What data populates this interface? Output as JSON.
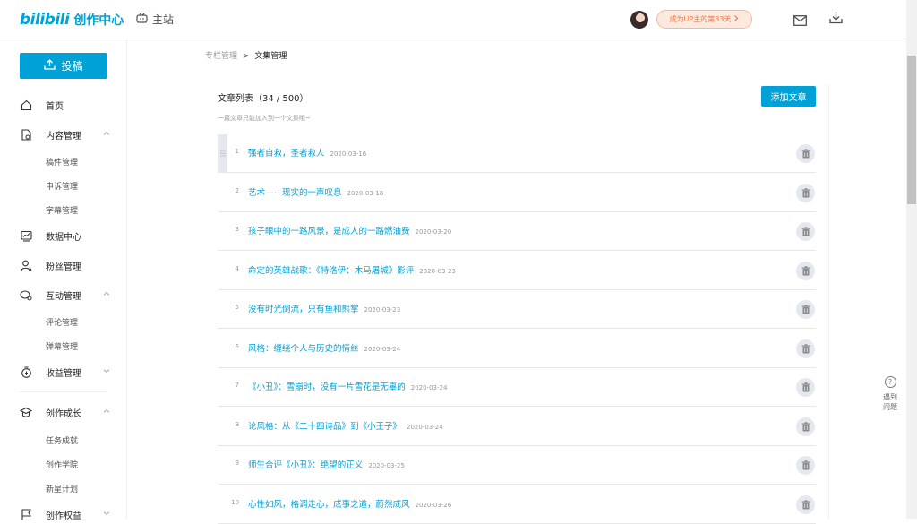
{
  "header": {
    "logo_bili": "bilibili",
    "logo_text": "创作中心",
    "home_label": "主站",
    "up_days_label": "成为UP主的第83天"
  },
  "sidebar": {
    "upload_label": "投稿",
    "items": [
      {
        "label": "首页",
        "icon": "home-icon"
      },
      {
        "label": "内容管理",
        "icon": "file-icon",
        "sub": [
          "稿件管理",
          "申诉管理",
          "字幕管理"
        ]
      },
      {
        "label": "数据中心",
        "icon": "chart-icon"
      },
      {
        "label": "粉丝管理",
        "icon": "fans-icon"
      },
      {
        "label": "互动管理",
        "icon": "chat-icon",
        "sub": [
          "评论管理",
          "弹幕管理"
        ]
      },
      {
        "label": "收益管理",
        "icon": "money-icon"
      },
      {
        "label": "创作成长",
        "icon": "grad-cap-icon",
        "sub": [
          "任务成就",
          "创作学院",
          "新星计划"
        ]
      },
      {
        "label": "创作权益",
        "icon": "flag-icon"
      }
    ]
  },
  "breadcrumb": {
    "parent": "专栏管理",
    "separator": ">",
    "current": "文集管理"
  },
  "list": {
    "title": "文章列表（34 / 500）",
    "tip": "一篇文章只能加入到一个文集哦~",
    "add_button": "添加文章",
    "rows": [
      {
        "index": "1",
        "title": "强者自救，圣者救人",
        "date": "2020-03-16"
      },
      {
        "index": "2",
        "title": "艺术——现实的一声叹息",
        "date": "2020-03-18"
      },
      {
        "index": "3",
        "title": "孩子眼中的一路风景，是成人的一路燃油费",
        "date": "2020-03-20"
      },
      {
        "index": "4",
        "title": "命定的英雄战歌：《特洛伊：木马屠城》影评",
        "date": "2020-03-23"
      },
      {
        "index": "5",
        "title": "没有时光倒流，只有鱼和熊掌",
        "date": "2020-03-23"
      },
      {
        "index": "6",
        "title": "风格：缠绕个人与历史的情丝",
        "date": "2020-03-24"
      },
      {
        "index": "7",
        "title": "《小丑》：雪崩时，没有一片雪花是无辜的",
        "date": "2020-03-24"
      },
      {
        "index": "8",
        "title": "论风格：从《二十四诗品》到《小王子》",
        "date": "2020-03-24"
      },
      {
        "index": "9",
        "title": "师生合评《小丑》：绝望的正义",
        "date": "2020-03-25"
      },
      {
        "index": "10",
        "title": "心性如风，格调走心，成事之道，蔚然成风",
        "date": "2020-03-26"
      }
    ]
  },
  "help": {
    "icon_glyph": "?",
    "line1": "遇到",
    "line2": "问题"
  },
  "colors": {
    "accent": "#00a1d6",
    "up_pill_text": "#f07a4a"
  }
}
